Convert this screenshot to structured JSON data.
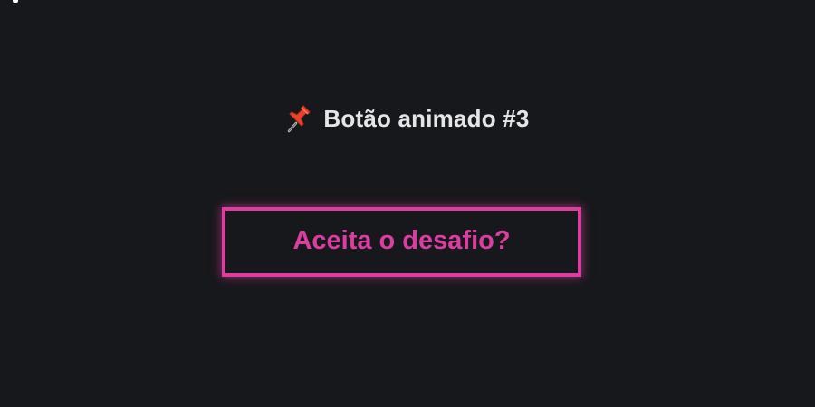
{
  "header": {
    "icon": "pushpin-icon",
    "title": "Botão animado #3"
  },
  "cta": {
    "label": "Aceita o desafio?"
  },
  "colors": {
    "background": "#17181c",
    "title_text": "#e6e6e6",
    "accent": "#db3e9f",
    "pin_red": "#e8432c"
  }
}
